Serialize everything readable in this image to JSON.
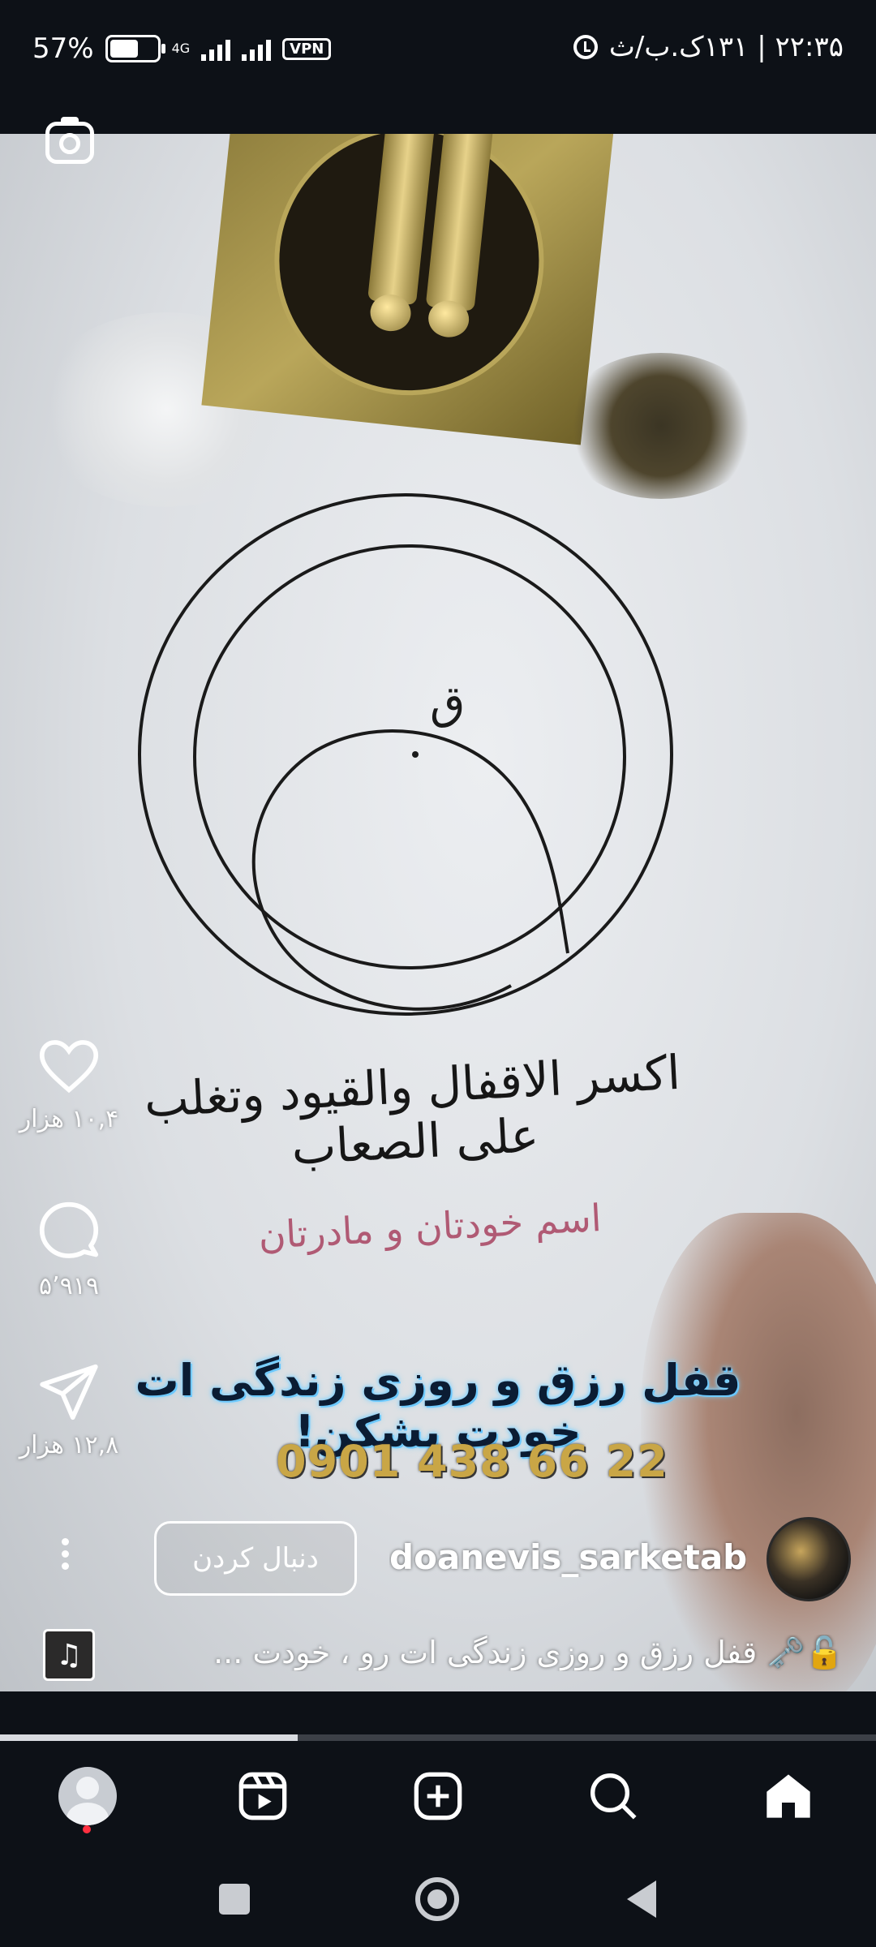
{
  "status_bar": {
    "battery": "57%",
    "network": "4G",
    "vpn": "VPN",
    "datetime": "۲۲:۳۵ | ۱۳۱ک.ب/ث",
    "battery_level": 0.57
  },
  "video": {
    "handwriting_line1": "اکسر الاقفال والقیود وتغلب علی الصعاب",
    "handwriting_line2": "اسم خودتان و مادرتان",
    "spiral_letter": "ق",
    "overlay_text": "قفل رزق و روزی زندگی ات خودت بشکن!",
    "overlay_phone": "0901 438 66 22"
  },
  "actions": {
    "likes": "۱۰,۴ هزار",
    "comments": "۵٬۹۱۹",
    "shares": "۱۲,۸ هزار"
  },
  "author": {
    "username": "doanevis_sarketab...",
    "follow_label": "دنبال کردن"
  },
  "caption": "🔓🗝️ قفل رزق و روزی زندگی ات رو ، خودت ...",
  "music_icon": "♫",
  "playback_progress": 0.34,
  "bottom_nav": [
    "profile",
    "reels",
    "create",
    "search",
    "home"
  ],
  "colors": {
    "background": "#0d1117",
    "notification_dot": "#ff3040",
    "overlay_glow": "#7fd2ff",
    "phone_gold": "#c9a646"
  }
}
